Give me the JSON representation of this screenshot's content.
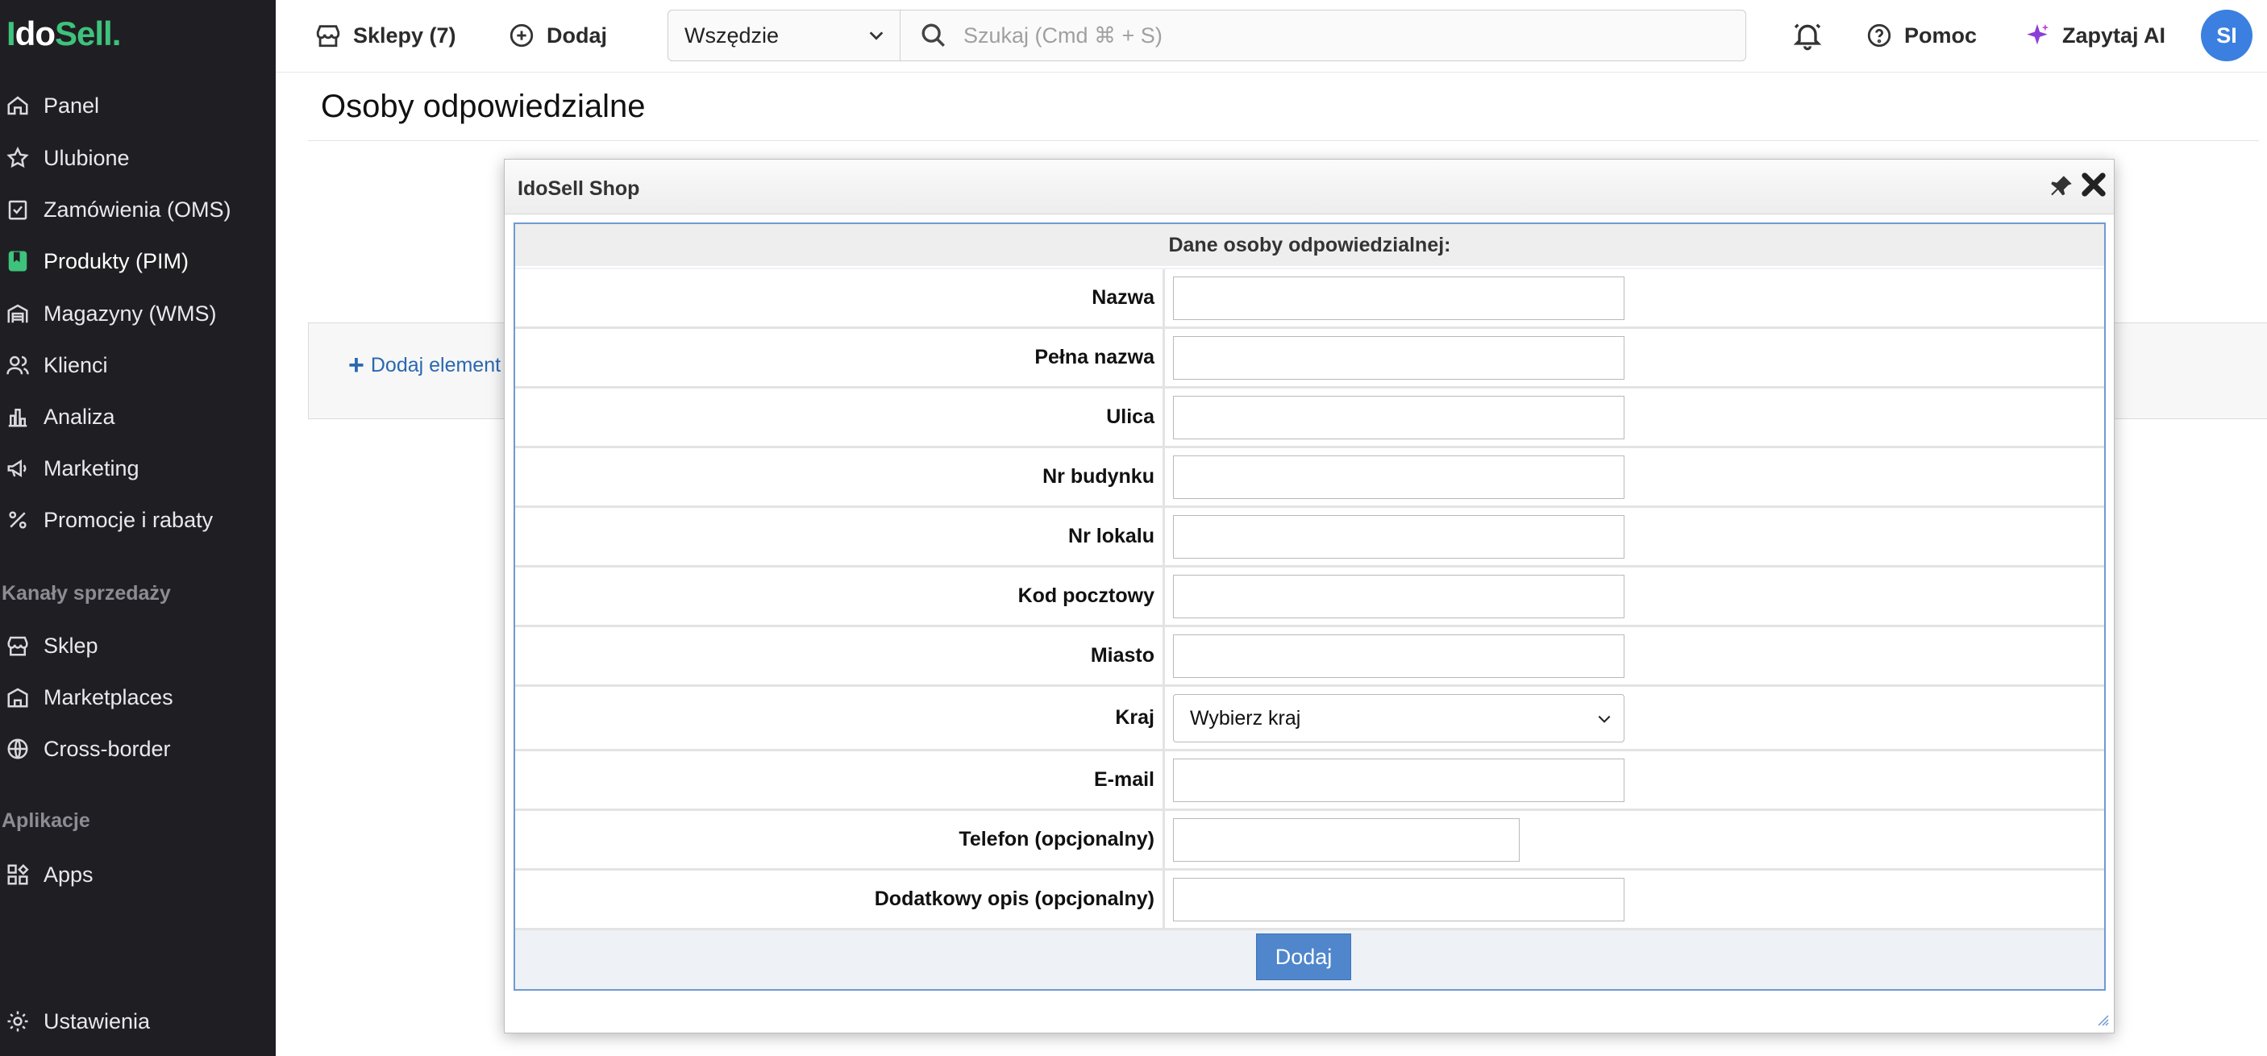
{
  "logo": {
    "part1": "I",
    "part2": "do",
    "part3": "Sell."
  },
  "sidebar": {
    "items": [
      {
        "label": "Panel",
        "icon": "home-icon"
      },
      {
        "label": "Ulubione",
        "icon": "star-icon"
      },
      {
        "label": "Zamówienia (OMS)",
        "icon": "clipboard-check-icon"
      },
      {
        "label": "Produkty (PIM)",
        "icon": "book-icon",
        "active": true
      },
      {
        "label": "Magazyny (WMS)",
        "icon": "warehouse-icon"
      },
      {
        "label": "Klienci",
        "icon": "users-icon"
      },
      {
        "label": "Analiza",
        "icon": "bar-chart-icon"
      },
      {
        "label": "Marketing",
        "icon": "megaphone-icon"
      },
      {
        "label": "Promocje i rabaty",
        "icon": "percent-icon"
      }
    ],
    "section_sales": "Kanały sprzedaży",
    "sales_items": [
      {
        "label": "Sklep",
        "icon": "store-icon"
      },
      {
        "label": "Marketplaces",
        "icon": "marketplace-icon"
      },
      {
        "label": "Cross-border",
        "icon": "globe-icon"
      }
    ],
    "section_apps": "Aplikacje",
    "apps_items": [
      {
        "label": "Apps",
        "icon": "apps-grid-icon"
      }
    ],
    "settings": "Ustawienia"
  },
  "topbar": {
    "shops": "Sklepy (7)",
    "add": "Dodaj",
    "scope": "Wszędzie",
    "search_placeholder": "Szukaj (Cmd ⌘ + S)",
    "help": "Pomoc",
    "ask_ai": "Zapytaj AI",
    "avatar_initials": "SI"
  },
  "main": {
    "page_title": "Osoby odpowiedzialne",
    "add_element": "Dodaj element"
  },
  "modal": {
    "title": "IdoSell Shop",
    "form_header": "Dane osoby odpowiedzialnej:",
    "fields": {
      "name": "Nazwa",
      "full_name": "Pełna nazwa",
      "street": "Ulica",
      "building": "Nr budynku",
      "unit": "Nr lokalu",
      "postal": "Kod pocztowy",
      "city": "Miasto",
      "country": "Kraj",
      "country_value": "Wybierz kraj",
      "email": "E-mail",
      "phone": "Telefon (opcjonalny)",
      "extra": "Dodatkowy opis (opcjonalny)"
    },
    "submit": "Dodaj"
  },
  "colors": {
    "brand_green": "#3ec27c",
    "sidebar_bg": "#1f1f23",
    "link_blue": "#2a67b1",
    "button_blue": "#4f86cc"
  }
}
